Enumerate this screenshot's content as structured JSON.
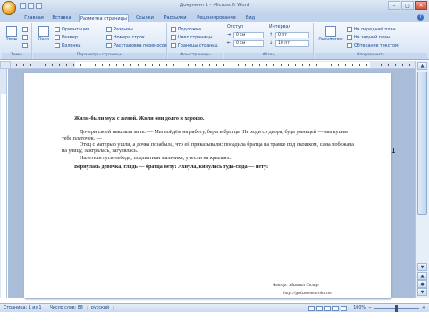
{
  "window": {
    "title": "Документ1 - Microsoft Word",
    "controls": [
      "minimize-icon",
      "maximize-icon",
      "close-icon"
    ],
    "control_glyphs": {
      "minimize": "–",
      "maximize": "□",
      "close": "✕"
    }
  },
  "tabs": [
    {
      "label": "Главная"
    },
    {
      "label": "Вставка"
    },
    {
      "label": "Разметка страницы",
      "active": true
    },
    {
      "label": "Ссылки"
    },
    {
      "label": "Рассылки"
    },
    {
      "label": "Рецензирование"
    },
    {
      "label": "Вид"
    }
  ],
  "help_glyph": "?",
  "ribbon": {
    "themes": {
      "label": "Темы",
      "big_button": "Темы",
      "small": [
        "",
        "",
        ""
      ]
    },
    "page_setup": {
      "label": "Параметры страницы",
      "big_buttons": [
        "Поля"
      ],
      "small": [
        "Ориентация",
        "Размер",
        "Колонки",
        "Разрывы",
        "Номера строк",
        "Расстановка переносов"
      ]
    },
    "page_background": {
      "label": "Фон страницы",
      "small": [
        "Подложка",
        "Цвет страницы",
        "Границы страниц"
      ]
    },
    "paragraph": {
      "label": "Абзац",
      "indent_label": "Отступ",
      "spacing_label": "Интервал",
      "left_prefix": "⇥",
      "right_prefix": "⇤",
      "before_prefix": "↑",
      "after_prefix": "↓",
      "indent_left": "0 см",
      "indent_right": "0 см",
      "spacing_before": "0 пт",
      "spacing_after": "10 пт"
    },
    "arrange": {
      "label": "Упорядочить",
      "big_button": "Положение",
      "small": [
        "На передний план",
        "На задний план",
        "Обтекание текстом"
      ]
    }
  },
  "document": {
    "lines": [
      "Жили-были муж с женой. Жили они долго и хорошо.",
      "Дочери своей наказала мать: — Мы пойдём на работу, береги братца! Не ходи со двора, будь умницей — мы купим",
      "тебе платочек. —",
      "Отец с матерью ушли, а дочка позабыла, что ей приказывали: посадила братца на травке под окошком, сама побежала",
      "на улицу, заигралась, загулялась.",
      "Налетели гуси-лебеди, подхватили мальчика, унесли на крыльях.",
      "Вернулась девочка, глядь — братца нету! Ахнула, кинулась туда-сюда — нету!"
    ],
    "author": "Автор: Михаил Скляр",
    "url": "http://goisnomenrok.com",
    "cursor_glyph": "I"
  },
  "scrollbar": {
    "up_glyph": "▲",
    "down_glyph": "▼",
    "prev_page_glyph": "▲",
    "select_glyph": "●",
    "next_page_glyph": "▼"
  },
  "status": {
    "page": "Страница: 1 из 1",
    "words": "Число слов: 88",
    "language": "русский",
    "zoom": "100%",
    "zoom_minus": "−",
    "zoom_plus": "+"
  }
}
